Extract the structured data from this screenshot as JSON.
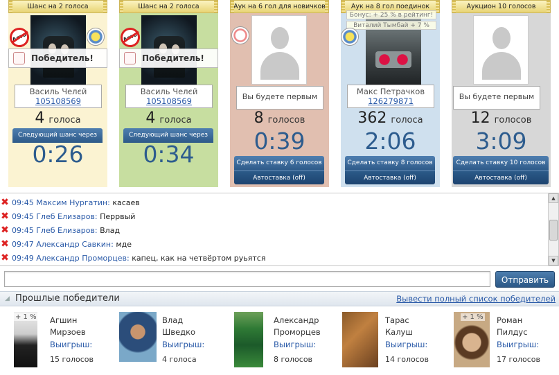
{
  "cards": [
    {
      "header": "Шанс на 2 голоса",
      "banner": "Победитель!",
      "name": "Василь Челєй",
      "id": "105108569",
      "votes": "4",
      "votes_word": "голоса",
      "bar_label": "Следующий шанс через",
      "timer": "0:26",
      "bg": "#fbf3d2",
      "no_auto_badge": "Авто"
    },
    {
      "header": "Шанс на 2 голоса",
      "banner": "Победитель!",
      "name": "Василь Челєй",
      "id": "105108569",
      "votes": "4",
      "votes_word": "голоса",
      "bar_label": "Следующий шанс через",
      "timer": "0:34",
      "bg": "#c7dea0",
      "no_auto_badge": "Авто"
    },
    {
      "header": "Аук на 6 гол для новичков",
      "placeholder": "Вы будете первым",
      "votes": "8",
      "votes_word": "голосов",
      "timer": "0:39",
      "bet_label": "Сделать ставку 6 голосов",
      "auto_label": "Автоставка (off)",
      "bg": "#e1bfb0"
    },
    {
      "header": "Аук на 8 гол поединок",
      "bonus_line": "Бонус: + 25 % в рейтинг!",
      "bonus_name": "Виталий Тымбай + 7 %",
      "name": "Макс Петрачков",
      "id": "126279871",
      "votes": "362",
      "votes_word": "голоса",
      "timer": "2:06",
      "bet_label": "Сделать ставку 8 голосов",
      "auto_label": "Автоставка (off)",
      "bg": "#cfe0ee"
    },
    {
      "header": "Аукцион 10 голосов",
      "placeholder": "Вы будете первым",
      "votes": "12",
      "votes_word": "голосов",
      "timer": "3:09",
      "bet_label": "Сделать ставку 10 голосов",
      "auto_label": "Автоставка (off)",
      "bg": "#d7d7d7"
    }
  ],
  "chat": [
    {
      "time": "09:45",
      "author": "Максим Нургатин:",
      "text": "касаев"
    },
    {
      "time": "09:45",
      "author": "Глеб Елизаров:",
      "text": "Перрвый"
    },
    {
      "time": "09:45",
      "author": "Глеб Елизаров:",
      "text": "Влад"
    },
    {
      "time": "09:47",
      "author": "Александр Савкин:",
      "text": "мде"
    },
    {
      "time": "09:49",
      "author": "Александр Проморцев:",
      "text": "капец, как на четвёртом руьятся"
    }
  ],
  "input": {
    "value": "",
    "send_label": "Отправить"
  },
  "past_winners": {
    "title": "Прошлые победители",
    "full_list_link": "Вывести полный список победителей",
    "win_label": "Выигрыш:",
    "items": [
      {
        "first": "Агшин",
        "last": "Мирзоев",
        "prize": "15 голосов",
        "badge": "+ 1 %"
      },
      {
        "first": "Влад",
        "last": "Шведко",
        "prize": "4 голоса",
        "badge": ""
      },
      {
        "first": "Александр",
        "last": "Проморцев",
        "prize": "8 голосов",
        "badge": ""
      },
      {
        "first": "Тарас",
        "last": "Калуш",
        "prize": "14 голосов",
        "badge": ""
      },
      {
        "first": "Роман",
        "last": "Пилдус",
        "prize": "17 голосов",
        "badge": "+ 1 %"
      }
    ]
  },
  "colors": {
    "accent": "#2d5c8e",
    "link": "#2a5aa8",
    "error_x": "#dd2222"
  }
}
